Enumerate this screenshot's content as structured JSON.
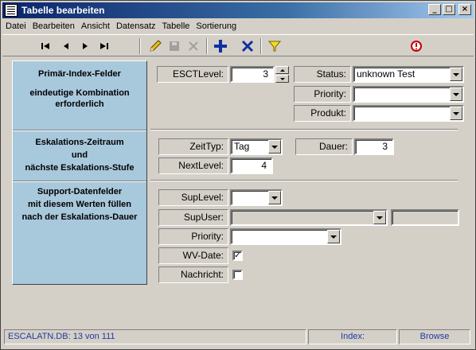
{
  "window": {
    "title": "Tabelle bearbeiten"
  },
  "menu": [
    "Datei",
    "Bearbeiten",
    "Ansicht",
    "Datensatz",
    "Tabelle",
    "Sortierung"
  ],
  "toolbar": {
    "nav_first": "|◀",
    "nav_prev": "◀",
    "nav_next": "▶",
    "nav_last": "▶|"
  },
  "panel": {
    "section1_line1": "Primär-Index-Felder",
    "section1_line2": "eindeutige Kombination",
    "section1_line3": "erforderlich",
    "section2_line1": "Eskalations-Zeitraum",
    "section2_line2": "und",
    "section2_line3": "nächste Eskalations-Stufe",
    "section3_line1": "Support-Datenfelder",
    "section3_line2": "mit diesem Werten füllen",
    "section3_line3": "nach der Eskalations-Dauer"
  },
  "fields": {
    "escl_level_label": "ESCTLevel:",
    "escl_level_value": "3",
    "status_label": "Status:",
    "status_value": "unknown Test",
    "priority1_label": "Priority:",
    "priority1_value": "",
    "produkt_label": "Produkt:",
    "produkt_value": "",
    "zeittyp_label": "ZeitTyp:",
    "zeittyp_value": "Tag",
    "dauer_label": "Dauer:",
    "dauer_value": "3",
    "nextlevel_label": "NextLevel:",
    "nextlevel_value": "4",
    "suplevel_label": "SupLevel:",
    "suplevel_value": "",
    "supuser_label": "SupUser:",
    "supuser_value": "",
    "supuser_extra": "",
    "priority2_label": "Priority:",
    "priority2_value": "",
    "wvdate_label": "WV-Date:",
    "wvdate_checked": "✓",
    "nachricht_label": "Nachricht:",
    "nachricht_checked": ""
  },
  "statusbar": {
    "record": "ESCALATN.DB: 13  von  111",
    "index": "Index:",
    "mode": "Browse"
  },
  "colors": {
    "panel": "#a8c8dc",
    "titlebar": "#0a246a",
    "status_text": "#1f3aa0"
  },
  "icons": [
    "first-record-icon",
    "prev-record-icon",
    "next-record-icon",
    "last-record-icon",
    "edit-pencil-icon",
    "save-icon",
    "cancel-x-icon",
    "insert-plus-icon",
    "delete-x-icon",
    "filter-funnel-icon",
    "stop-icon"
  ]
}
